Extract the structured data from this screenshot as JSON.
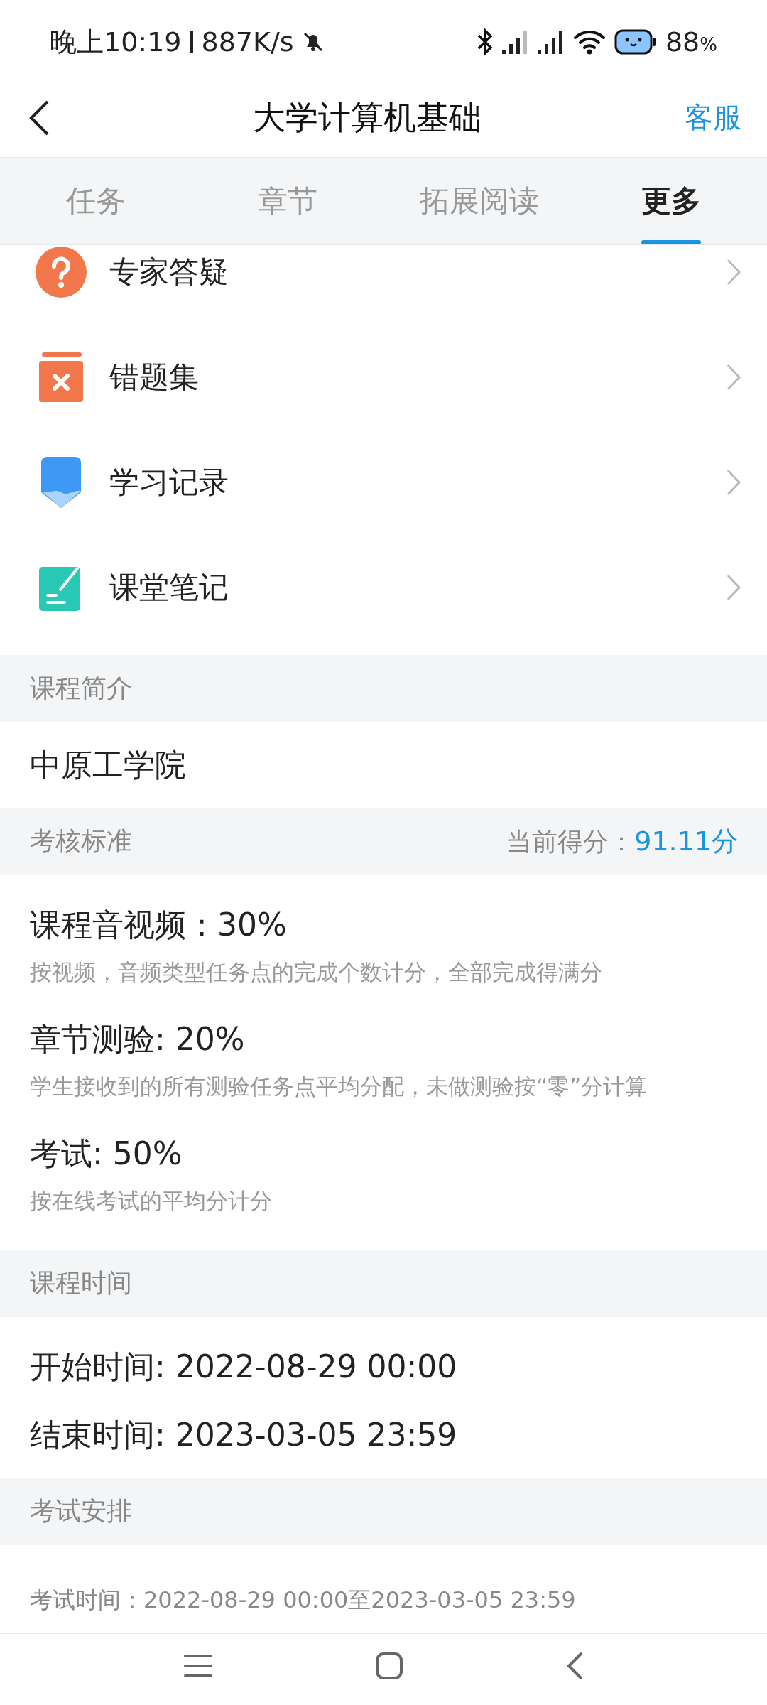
{
  "status_bar": {
    "time": "晚上10:19",
    "speed": "887K/s",
    "battery": "88",
    "battery_unit": "%"
  },
  "nav": {
    "title": "大学计算机基础",
    "action": "客服"
  },
  "tabs": [
    {
      "label": "任务",
      "selected": false
    },
    {
      "label": "章节",
      "selected": false
    },
    {
      "label": "拓展阅读",
      "selected": false
    },
    {
      "label": "更多",
      "selected": true
    }
  ],
  "menu": [
    {
      "kind": "question",
      "label": "专家答疑"
    },
    {
      "kind": "wrong",
      "label": "错题集"
    },
    {
      "kind": "record",
      "label": "学习记录"
    },
    {
      "kind": "notes",
      "label": "课堂笔记"
    }
  ],
  "intro": {
    "header": "课程简介",
    "text": "中原工学院"
  },
  "grading": {
    "header": "考核标准",
    "score_label": "当前得分：",
    "score": "91.11分",
    "items": [
      {
        "title": "课程音视频：30%",
        "desc": "按视频，音频类型任务点的完成个数计分，全部完成得满分"
      },
      {
        "title": "章节测验: 20%",
        "desc": "学生接收到的所有测验任务点平均分配，未做测验按“零”分计算"
      },
      {
        "title": "考试: 50%",
        "desc": "按在线考试的平均分计分"
      }
    ]
  },
  "schedule": {
    "header": "课程时间",
    "start": "开始时间: 2022-08-29 00:00",
    "end": "结束时间: 2023-03-05 23:59"
  },
  "exam": {
    "header": "考试安排",
    "time": "考试时间：2022-08-29 00:00至2023-03-05 23:59"
  }
}
